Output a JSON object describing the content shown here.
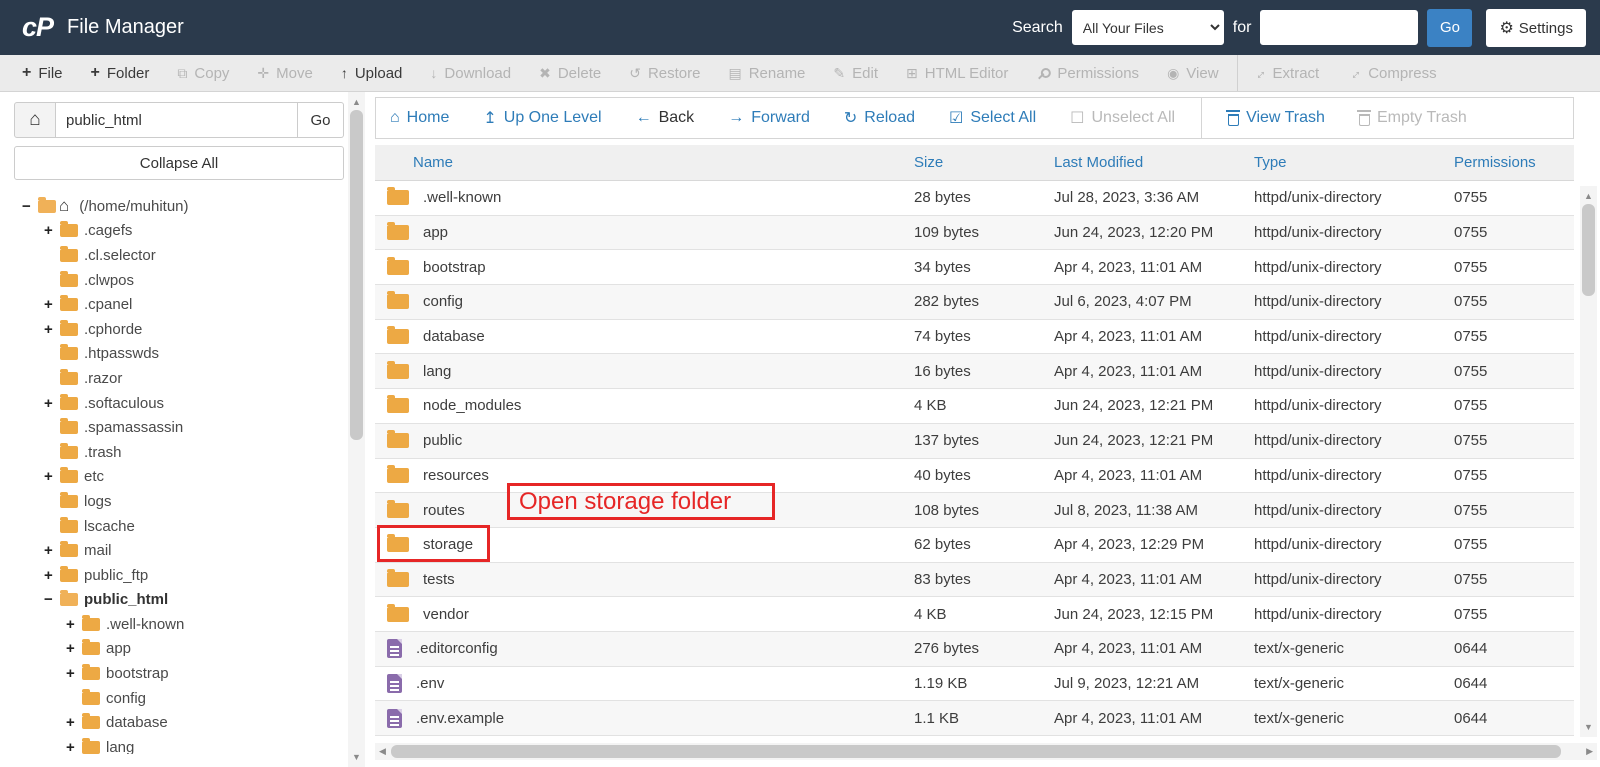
{
  "topbar": {
    "logo": "cP",
    "title": "File Manager",
    "search_label": "Search",
    "search_scope": "All Your Files",
    "for_label": "for",
    "search_value": "",
    "go_label": "Go",
    "settings_label": "Settings"
  },
  "toolbar": {
    "items": [
      {
        "label": "File",
        "icon": "new-file-plus-icon",
        "enabled": true
      },
      {
        "label": "Folder",
        "icon": "new-folder-plus-icon",
        "enabled": true
      },
      {
        "label": "Copy",
        "icon": "copy-icon",
        "enabled": false
      },
      {
        "label": "Move",
        "icon": "move-icon",
        "enabled": false
      },
      {
        "label": "Upload",
        "icon": "upload-icon",
        "enabled": true
      },
      {
        "label": "Download",
        "icon": "download-icon",
        "enabled": false
      },
      {
        "label": "Delete",
        "icon": "delete-icon",
        "enabled": false
      },
      {
        "label": "Restore",
        "icon": "restore-icon",
        "enabled": false
      },
      {
        "label": "Rename",
        "icon": "rename-icon",
        "enabled": false
      },
      {
        "label": "Edit",
        "icon": "edit-icon",
        "enabled": false
      },
      {
        "label": "HTML Editor",
        "icon": "html-editor-icon",
        "enabled": false
      },
      {
        "label": "Permissions",
        "icon": "key-icon",
        "enabled": false
      },
      {
        "label": "View",
        "icon": "eye-icon",
        "enabled": false
      },
      {
        "label": "Extract",
        "icon": "extract-icon",
        "enabled": false,
        "group_start": true
      },
      {
        "label": "Compress",
        "icon": "compress-icon",
        "enabled": false
      }
    ]
  },
  "sidebar": {
    "path_value": "public_html",
    "go_label": "Go",
    "collapse_all_label": "Collapse All",
    "tree": [
      {
        "label": "(/home/muhitun)",
        "level": 0,
        "expander": "−",
        "open": true,
        "home": true
      },
      {
        "label": ".cagefs",
        "level": 1,
        "expander": "+"
      },
      {
        "label": ".cl.selector",
        "level": 1,
        "expander": ""
      },
      {
        "label": ".clwpos",
        "level": 1,
        "expander": ""
      },
      {
        "label": ".cpanel",
        "level": 1,
        "expander": "+"
      },
      {
        "label": ".cphorde",
        "level": 1,
        "expander": "+"
      },
      {
        "label": ".htpasswds",
        "level": 1,
        "expander": ""
      },
      {
        "label": ".razor",
        "level": 1,
        "expander": ""
      },
      {
        "label": ".softaculous",
        "level": 1,
        "expander": "+"
      },
      {
        "label": ".spamassassin",
        "level": 1,
        "expander": ""
      },
      {
        "label": ".trash",
        "level": 1,
        "expander": ""
      },
      {
        "label": "etc",
        "level": 1,
        "expander": "+"
      },
      {
        "label": "logs",
        "level": 1,
        "expander": ""
      },
      {
        "label": "lscache",
        "level": 1,
        "expander": ""
      },
      {
        "label": "mail",
        "level": 1,
        "expander": "+"
      },
      {
        "label": "public_ftp",
        "level": 1,
        "expander": "+"
      },
      {
        "label": "public_html",
        "level": 1,
        "expander": "−",
        "open": true,
        "bold": true
      },
      {
        "label": ".well-known",
        "level": 2,
        "expander": "+"
      },
      {
        "label": "app",
        "level": 2,
        "expander": "+"
      },
      {
        "label": "bootstrap",
        "level": 2,
        "expander": "+"
      },
      {
        "label": "config",
        "level": 2,
        "expander": ""
      },
      {
        "label": "database",
        "level": 2,
        "expander": "+"
      },
      {
        "label": "lang",
        "level": 2,
        "expander": "+"
      }
    ]
  },
  "filenav": {
    "items": [
      {
        "label": "Home",
        "icon": "home-icon",
        "style": "link"
      },
      {
        "label": "Up One Level",
        "icon": "up-one-level-icon",
        "style": "link"
      },
      {
        "label": "Back",
        "icon": "back-arrow-icon",
        "style": "dark"
      },
      {
        "label": "Forward",
        "icon": "forward-arrow-icon",
        "style": "link"
      },
      {
        "label": "Reload",
        "icon": "reload-icon",
        "style": "link"
      },
      {
        "label": "Select All",
        "icon": "select-all-icon",
        "style": "link"
      },
      {
        "label": "Unselect All",
        "icon": "unselect-all-icon",
        "style": "disabled"
      },
      {
        "label": "View Trash",
        "icon": "trash-icon",
        "style": "link",
        "divider_before": true
      },
      {
        "label": "Empty Trash",
        "icon": "trash-icon",
        "style": "disabled"
      }
    ]
  },
  "table": {
    "columns": {
      "name": "Name",
      "size": "Size",
      "modified": "Last Modified",
      "type": "Type",
      "permissions": "Permissions"
    },
    "rows": [
      {
        "name": ".well-known",
        "kind": "folder",
        "size": "28 bytes",
        "modified": "Jul 28, 2023, 3:36 AM",
        "type": "httpd/unix-directory",
        "permissions": "0755"
      },
      {
        "name": "app",
        "kind": "folder",
        "size": "109 bytes",
        "modified": "Jun 24, 2023, 12:20 PM",
        "type": "httpd/unix-directory",
        "permissions": "0755"
      },
      {
        "name": "bootstrap",
        "kind": "folder",
        "size": "34 bytes",
        "modified": "Apr 4, 2023, 11:01 AM",
        "type": "httpd/unix-directory",
        "permissions": "0755"
      },
      {
        "name": "config",
        "kind": "folder",
        "size": "282 bytes",
        "modified": "Jul 6, 2023, 4:07 PM",
        "type": "httpd/unix-directory",
        "permissions": "0755"
      },
      {
        "name": "database",
        "kind": "folder",
        "size": "74 bytes",
        "modified": "Apr 4, 2023, 11:01 AM",
        "type": "httpd/unix-directory",
        "permissions": "0755"
      },
      {
        "name": "lang",
        "kind": "folder",
        "size": "16 bytes",
        "modified": "Apr 4, 2023, 11:01 AM",
        "type": "httpd/unix-directory",
        "permissions": "0755"
      },
      {
        "name": "node_modules",
        "kind": "folder",
        "size": "4 KB",
        "modified": "Jun 24, 2023, 12:21 PM",
        "type": "httpd/unix-directory",
        "permissions": "0755"
      },
      {
        "name": "public",
        "kind": "folder",
        "size": "137 bytes",
        "modified": "Jun 24, 2023, 12:21 PM",
        "type": "httpd/unix-directory",
        "permissions": "0755"
      },
      {
        "name": "resources",
        "kind": "folder",
        "size": "40 bytes",
        "modified": "Apr 4, 2023, 11:01 AM",
        "type": "httpd/unix-directory",
        "permissions": "0755"
      },
      {
        "name": "routes",
        "kind": "folder",
        "size": "108 bytes",
        "modified": "Jul 8, 2023, 11:38 AM",
        "type": "httpd/unix-directory",
        "permissions": "0755"
      },
      {
        "name": "storage",
        "kind": "folder",
        "size": "62 bytes",
        "modified": "Apr 4, 2023, 12:29 PM",
        "type": "httpd/unix-directory",
        "permissions": "0755"
      },
      {
        "name": "tests",
        "kind": "folder",
        "size": "83 bytes",
        "modified": "Apr 4, 2023, 11:01 AM",
        "type": "httpd/unix-directory",
        "permissions": "0755"
      },
      {
        "name": "vendor",
        "kind": "folder",
        "size": "4 KB",
        "modified": "Jun 24, 2023, 12:15 PM",
        "type": "httpd/unix-directory",
        "permissions": "0755"
      },
      {
        "name": ".editorconfig",
        "kind": "file",
        "size": "276 bytes",
        "modified": "Apr 4, 2023, 11:01 AM",
        "type": "text/x-generic",
        "permissions": "0644"
      },
      {
        "name": ".env",
        "kind": "file",
        "size": "1.19 KB",
        "modified": "Jul 9, 2023, 12:21 AM",
        "type": "text/x-generic",
        "permissions": "0644"
      },
      {
        "name": ".env.example",
        "kind": "file",
        "size": "1.1 KB",
        "modified": "Apr 4, 2023, 11:01 AM",
        "type": "text/x-generic",
        "permissions": "0644"
      }
    ]
  },
  "annotation": {
    "label": "Open storage folder",
    "highlighted_row": "storage"
  },
  "colors": {
    "topbar_bg": "#2b3a4c",
    "link_blue": "#2e7cb8",
    "go_button_blue": "#3b82c4",
    "folder_orange": "#eda944",
    "file_purple": "#8a6bab",
    "annotation_red": "#e62626"
  }
}
